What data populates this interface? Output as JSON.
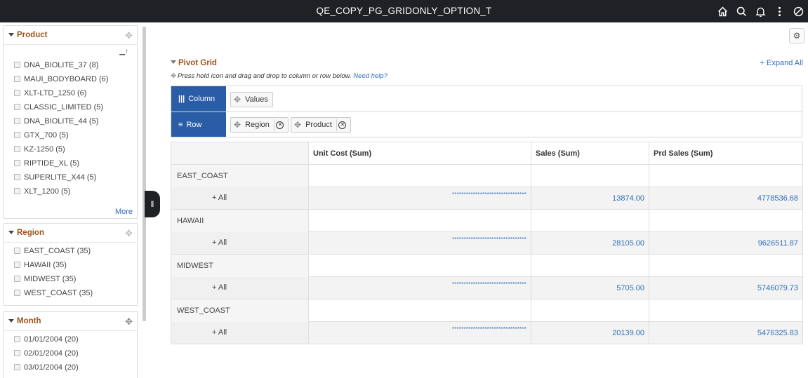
{
  "header": {
    "title": "QE_COPY_PG_GRIDONLY_OPTION_T",
    "icons": [
      "home-icon",
      "search-icon",
      "bell-icon",
      "more-vertical-icon",
      "no-entry-icon"
    ]
  },
  "filters": {
    "product": {
      "label": "Product",
      "items": [
        "DNA_BIOLITE_37 (8)",
        "MAUI_BODYBOARD (6)",
        "XLT-LTD_1250 (6)",
        "CLASSIC_LIMITED (5)",
        "DNA_BIOLITE_44 (5)",
        "GTX_700 (5)",
        "KZ-1250 (5)",
        "RIPTIDE_XL (5)",
        "SUPERLITE_X44 (5)",
        "XLT_1200 (5)"
      ],
      "more": "More"
    },
    "region": {
      "label": "Region",
      "items": [
        "EAST_COAST (35)",
        "HAWAII (35)",
        "MIDWEST (35)",
        "WEST_COAST (35)"
      ]
    },
    "month": {
      "label": "Month",
      "items": [
        "01/01/2004 (20)",
        "02/01/2004 (20)",
        "03/01/2004 (20)"
      ]
    }
  },
  "pivot": {
    "title": "Pivot Grid",
    "expand_all": "+ Expand All",
    "hint": "Press hold icon and drag and drop to column or row below.",
    "help_link": "Need help?",
    "column_label": "Column",
    "row_label": "Row",
    "column_fields": [
      "Values"
    ],
    "row_fields": [
      "Region",
      "Product"
    ],
    "headers": [
      "",
      "Unit Cost (Sum)",
      "Sales (Sum)",
      "Prd Sales (Sum)"
    ],
    "rows": [
      {
        "region": "EAST_COAST",
        "sub": "+ All",
        "unit_cost": "********************************",
        "sales": "13874.00",
        "prd_sales": "4778536.68"
      },
      {
        "region": "HAWAII",
        "sub": "+ All",
        "unit_cost": "********************************",
        "sales": "28105.00",
        "prd_sales": "9626511.87"
      },
      {
        "region": "MIDWEST",
        "sub": "+ All",
        "unit_cost": "********************************",
        "sales": "5705.00",
        "prd_sales": "5746079.73"
      },
      {
        "region": "WEST_COAST",
        "sub": "+ All",
        "unit_cost": "********************************",
        "sales": "20139.00",
        "prd_sales": "5476325.83"
      }
    ]
  }
}
